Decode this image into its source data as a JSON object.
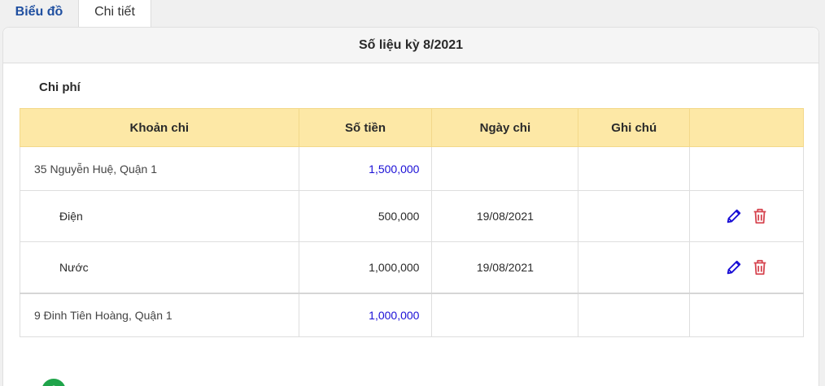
{
  "tabs": {
    "chart": "Biểu đồ",
    "detail": "Chi tiết"
  },
  "panel": {
    "title": "Số liệu kỳ 8/2021"
  },
  "section": {
    "title": "Chi phí"
  },
  "table": {
    "headers": [
      "Khoản chi",
      "Số tiền",
      "Ngày chi",
      "Ghi chú",
      ""
    ],
    "rows": [
      {
        "name": "35 Nguyễn Huệ, Quận 1",
        "amount": "1,500,000",
        "date": "",
        "note": ""
      },
      {
        "name": "Điện",
        "amount": "500,000",
        "date": "19/08/2021",
        "note": ""
      },
      {
        "name": "Nước",
        "amount": "1,000,000",
        "date": "19/08/2021",
        "note": ""
      },
      {
        "name": "9 Đinh Tiên Hoàng, Quận 1",
        "amount": "1,000,000",
        "date": "",
        "note": ""
      }
    ]
  },
  "icons": {
    "edit": "pencil-icon",
    "delete": "trash-icon",
    "add": "plus-icon"
  },
  "colors": {
    "accent_blue": "#1a0fd6",
    "tab_blue": "#1f4fa0",
    "header_yellow": "#fde8a6",
    "delete_red": "#d64550",
    "add_green": "#1fa44a"
  }
}
